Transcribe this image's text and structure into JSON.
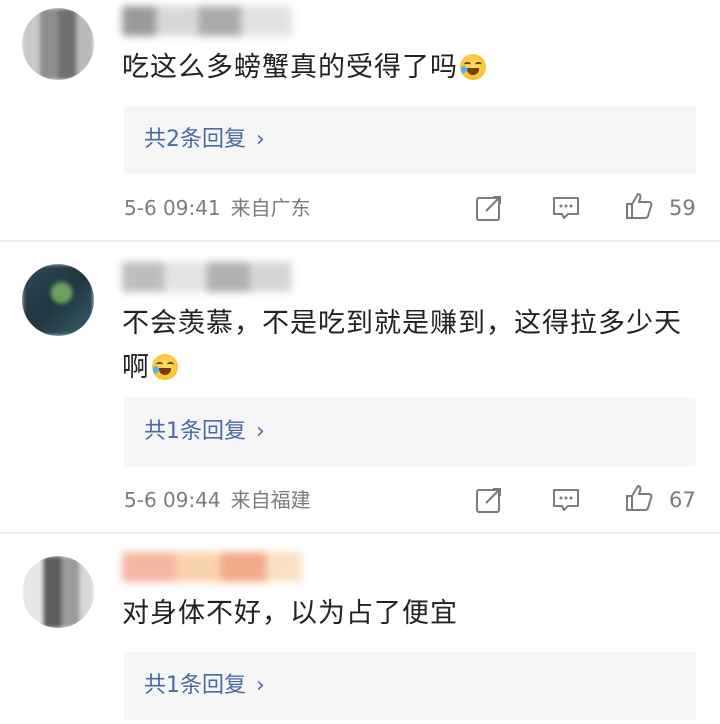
{
  "comments": [
    {
      "text": "吃这么多螃蟹真的受得了吗",
      "replies_label": "共2条回复",
      "date": "5-6 09:41",
      "location": "来自广东",
      "likes": "59"
    },
    {
      "text": "不会羡慕，不是吃到就是赚到，这得拉多少天啊",
      "replies_label": "共1条回复",
      "date": "5-6 09:44",
      "location": "来自福建",
      "likes": "67"
    },
    {
      "text": "对身体不好，以为占了便宜",
      "replies_label": "共1条回复"
    }
  ],
  "icons": {
    "emoji": "laugh-cry-emoji",
    "share": "share-icon",
    "comment": "comment-icon",
    "like": "thumbs-up-icon",
    "chevron": "chevron-right-icon"
  },
  "colors": {
    "reply_link": "#4a6aa3",
    "meta_text": "#7b7b7b",
    "reply_box": "#f6f6f6"
  }
}
